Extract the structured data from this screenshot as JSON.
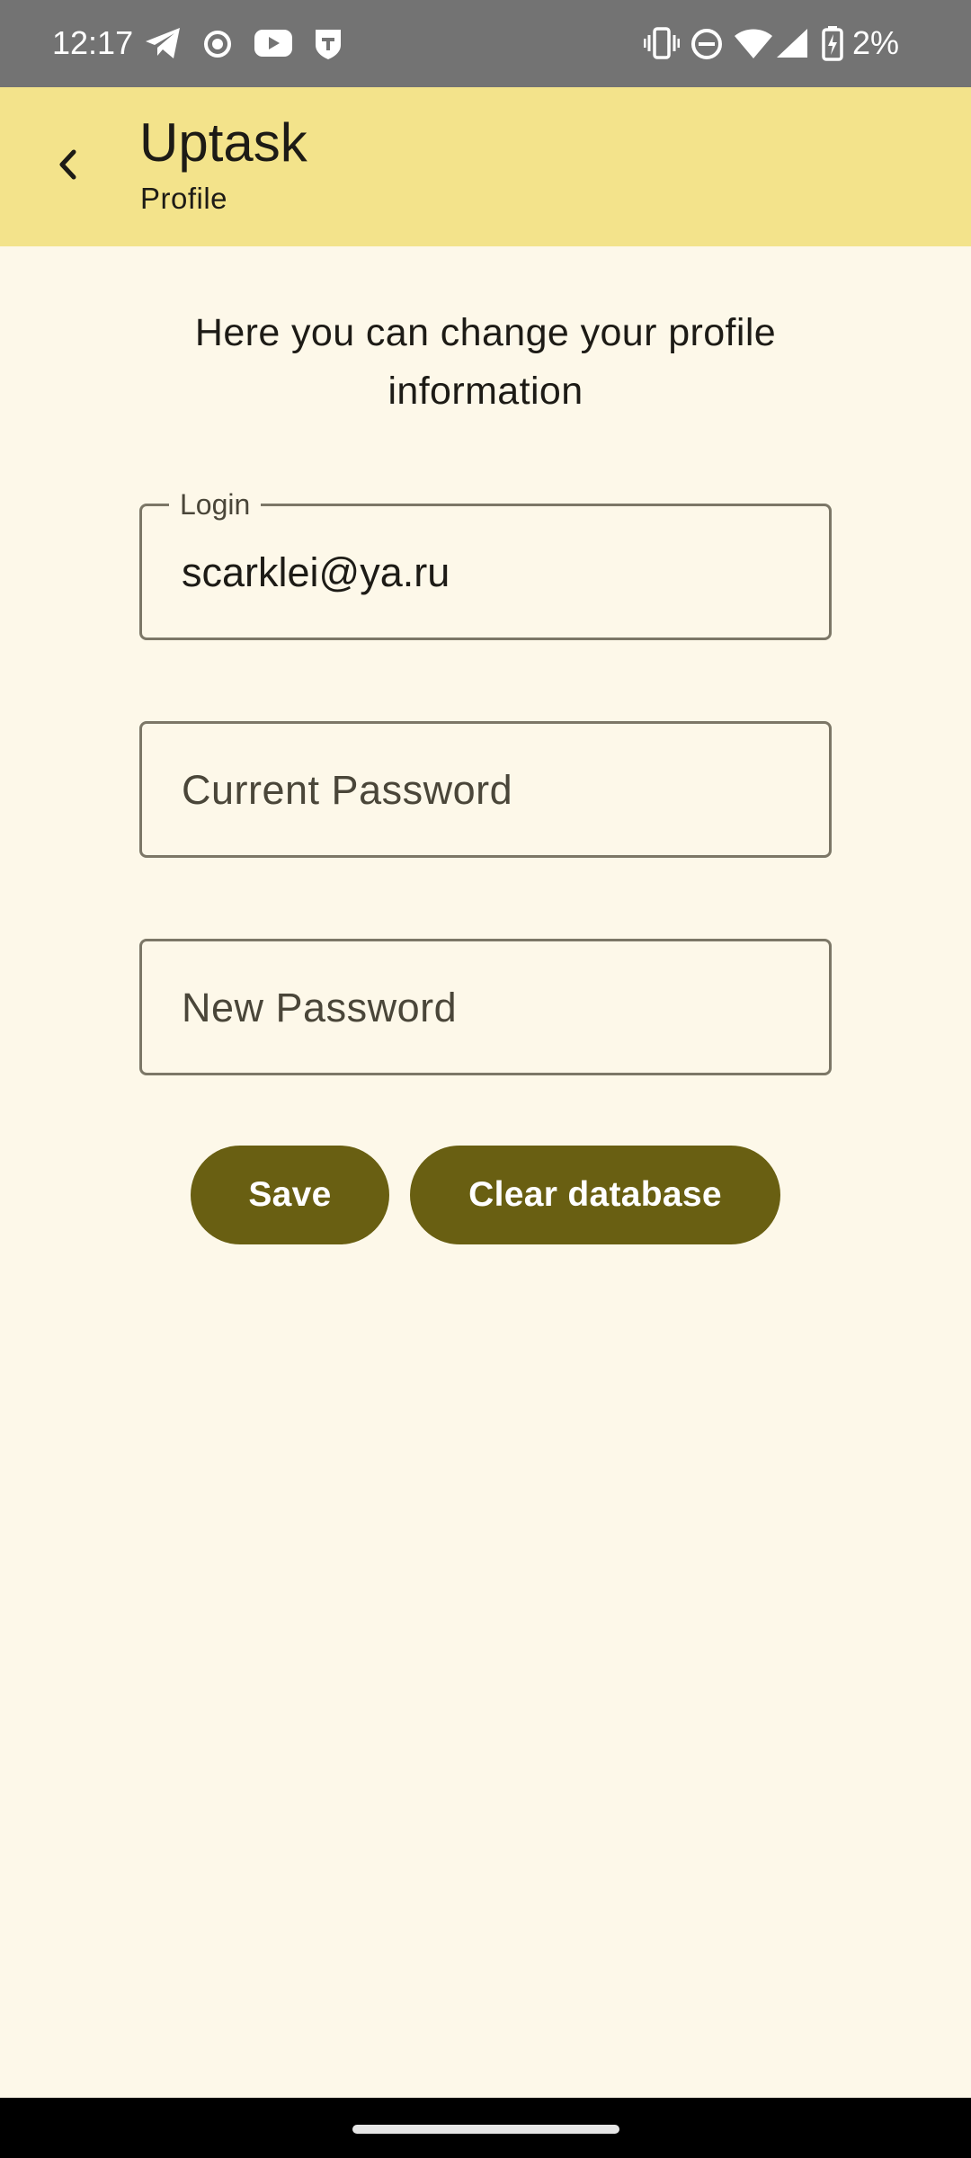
{
  "status_bar": {
    "time": "12:17",
    "battery_percent": "2%",
    "left_icons": [
      "telegram-icon",
      "record-icon",
      "youtube-icon",
      "shield-t-icon"
    ],
    "right_icons": [
      "vibrate-icon",
      "do-not-disturb-icon",
      "wifi-icon",
      "signal-icon",
      "battery-charging-icon"
    ]
  },
  "app_bar": {
    "title": "Uptask",
    "subtitle": "Profile"
  },
  "content": {
    "intro": "Here you can change your profile information",
    "login": {
      "label": "Login",
      "value": "scarklei@ya.ru"
    },
    "current_password": {
      "placeholder": "Current Password"
    },
    "new_password": {
      "placeholder": "New Password"
    },
    "save_label": "Save",
    "clear_label": "Clear database"
  },
  "colors": {
    "app_bar": "#f3e38b",
    "background": "#fdf8e9",
    "button": "#695f12",
    "status_bar": "#737373"
  }
}
